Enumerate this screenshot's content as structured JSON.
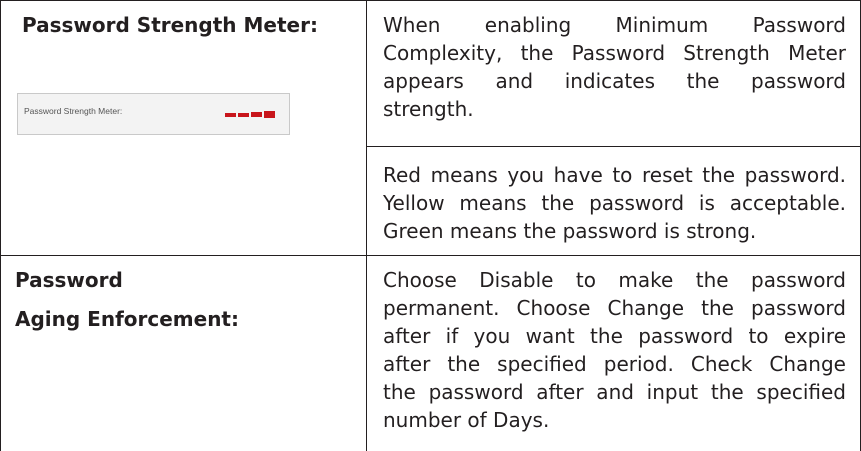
{
  "rows": [
    {
      "label": "Password Strength Meter:",
      "screenshot": {
        "label": "Password Strength Meter:",
        "strength_color": "#c8151b",
        "strength_level": "red"
      },
      "paragraphs": [
        [
          "When enabling Minimum Password",
          "Complexity, the Password Strength Meter",
          "appears and indicates the password",
          "strength."
        ],
        [
          "Red means you have to reset the password.",
          "Yellow means the password is acceptable.",
          "Green means the password  is strong."
        ]
      ]
    },
    {
      "label_lines": [
        "Password",
        "Aging Enforcement:"
      ],
      "paragraphs": [
        [
          "Choose Disable to make the password",
          "permanent. Choose Change the password",
          "after if you want the password to expire",
          "after the specified period. Check Change",
          "the password after and input the specified",
          "number of Days."
        ]
      ]
    }
  ]
}
